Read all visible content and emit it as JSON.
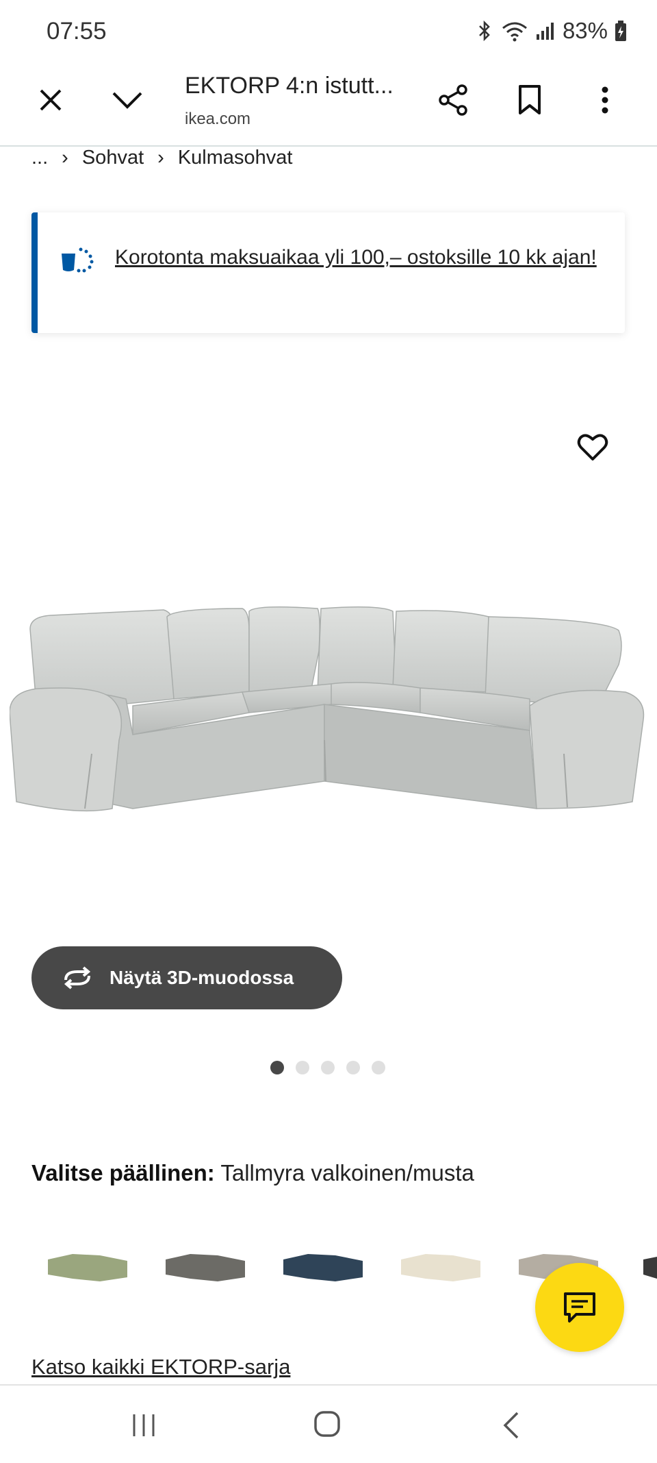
{
  "status_bar": {
    "time": "07:55",
    "battery": "83%"
  },
  "browser": {
    "page_title": "EKTORP 4:n istutt...",
    "domain": "ikea.com"
  },
  "breadcrumb": {
    "ellipsis": "...",
    "items": [
      "Sohvat",
      "Kulmasohvat"
    ]
  },
  "promo": {
    "text": "Korotonta maksuaikaa yli 100,– ostoksille 10 kk ajan!"
  },
  "product": {
    "view_3d_label": "Näytä 3D-muodossa",
    "image_count": 5,
    "active_image_index": 0
  },
  "cover": {
    "label": "Valitse päällinen:",
    "value": "Tallmyra valkoinen/musta",
    "swatch_colors": [
      "#9aa67e",
      "#6c6b66",
      "#2f4458",
      "#e8e1cf",
      "#b4ada2",
      "#3a3a3a"
    ]
  },
  "links": {
    "see_all": "Katso kaikki EKTORP-sarja"
  },
  "colors": {
    "accent_blue": "#0058a3",
    "chat_yellow": "#fcd913",
    "button_dark": "#484848"
  }
}
